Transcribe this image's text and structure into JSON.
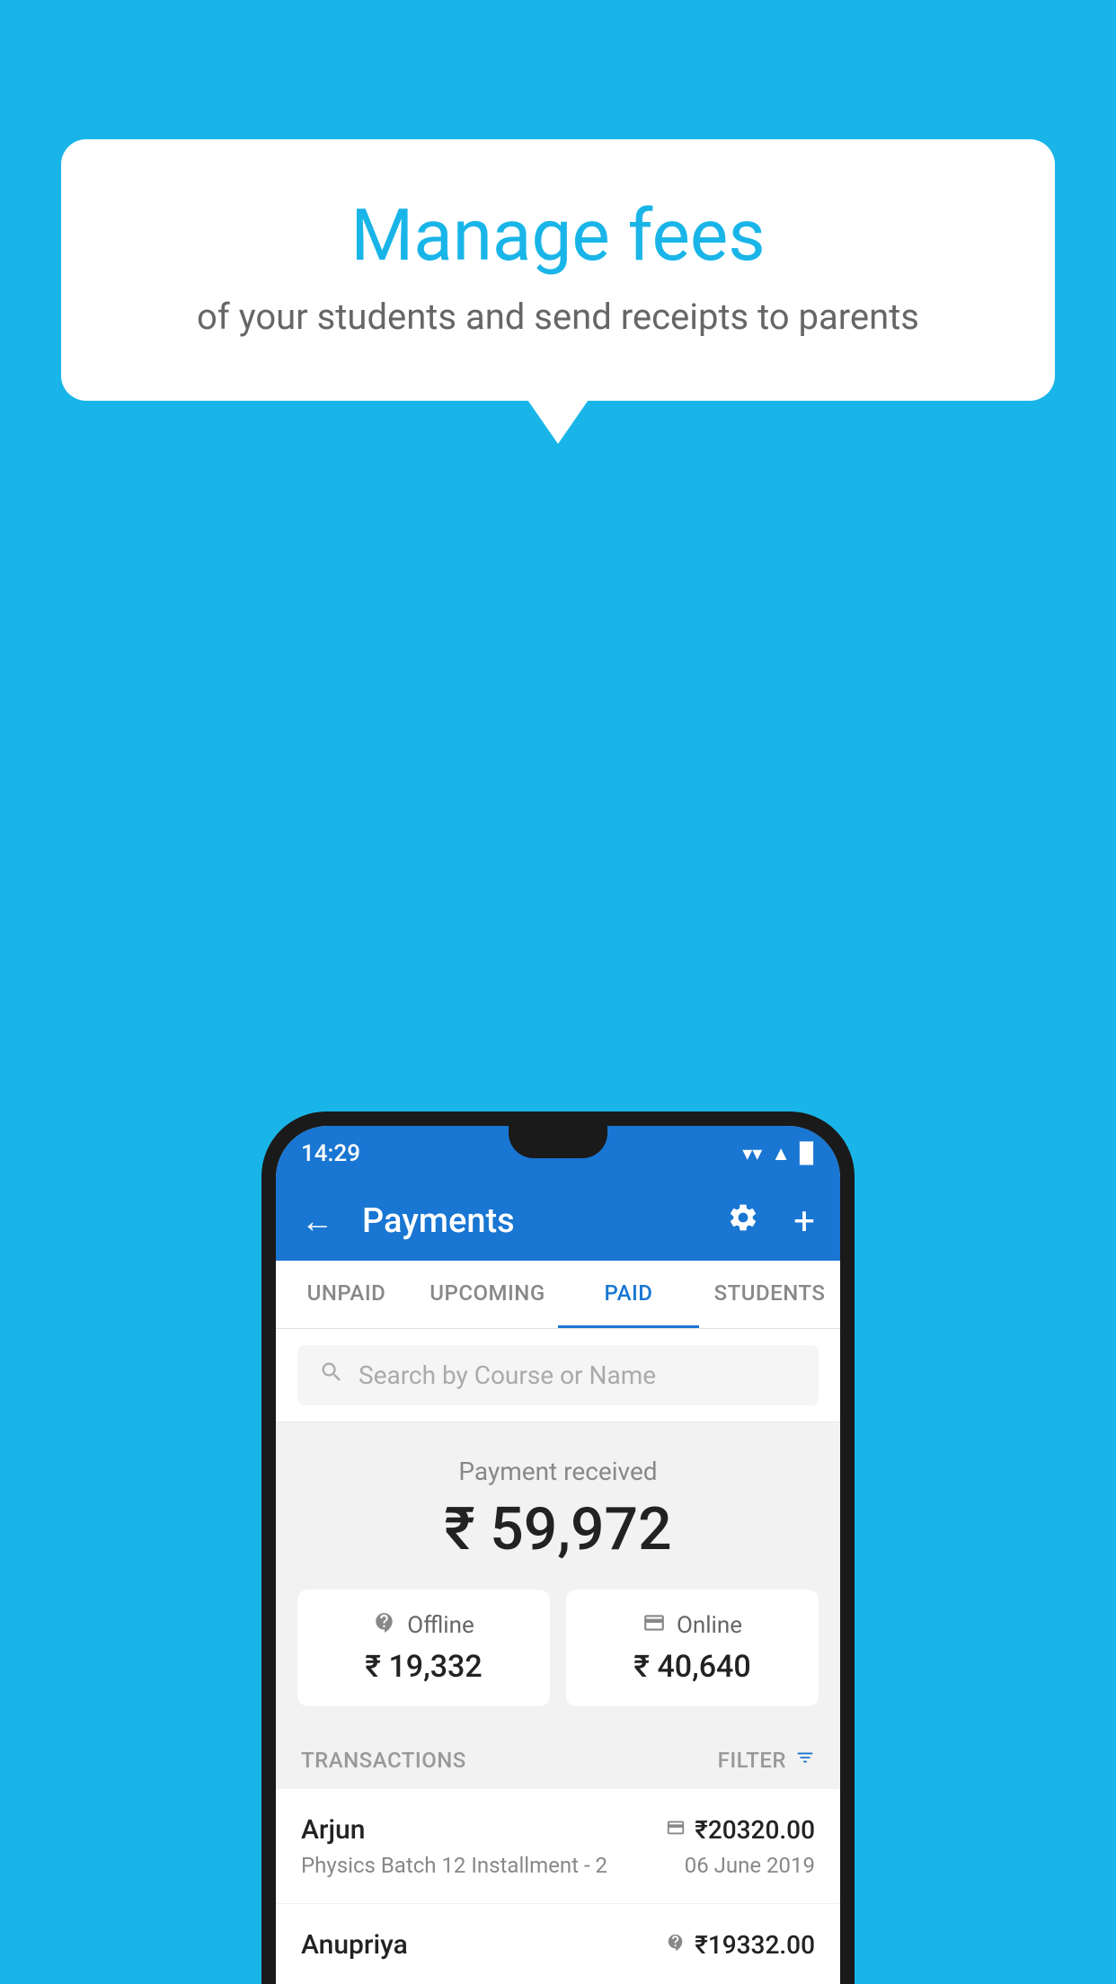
{
  "background_color": "#1ab5e8",
  "speech_bubble": {
    "title": "Manage fees",
    "subtitle": "of your students and send receipts to parents"
  },
  "status_bar": {
    "time": "14:29",
    "wifi": "▲",
    "signal": "▲",
    "battery": "▉"
  },
  "header": {
    "title": "Payments",
    "back_label": "←",
    "gear_label": "⚙",
    "plus_label": "+"
  },
  "tabs": [
    {
      "label": "UNPAID",
      "active": false
    },
    {
      "label": "UPCOMING",
      "active": false
    },
    {
      "label": "PAID",
      "active": true
    },
    {
      "label": "STUDENTS",
      "active": false
    }
  ],
  "search": {
    "placeholder": "Search by Course or Name"
  },
  "payment": {
    "label": "Payment received",
    "amount": "₹ 59,972",
    "offline": {
      "label": "Offline",
      "amount": "₹ 19,332"
    },
    "online": {
      "label": "Online",
      "amount": "₹ 40,640"
    }
  },
  "transactions_section": {
    "label": "TRANSACTIONS",
    "filter_label": "FILTER"
  },
  "transactions": [
    {
      "name": "Arjun",
      "amount": "₹20320.00",
      "course": "Physics Batch 12 Installment - 2",
      "date": "06 June 2019",
      "payment_type": "online"
    },
    {
      "name": "Anupriya",
      "amount": "₹19332.00",
      "course": "",
      "date": "",
      "payment_type": "offline"
    }
  ]
}
